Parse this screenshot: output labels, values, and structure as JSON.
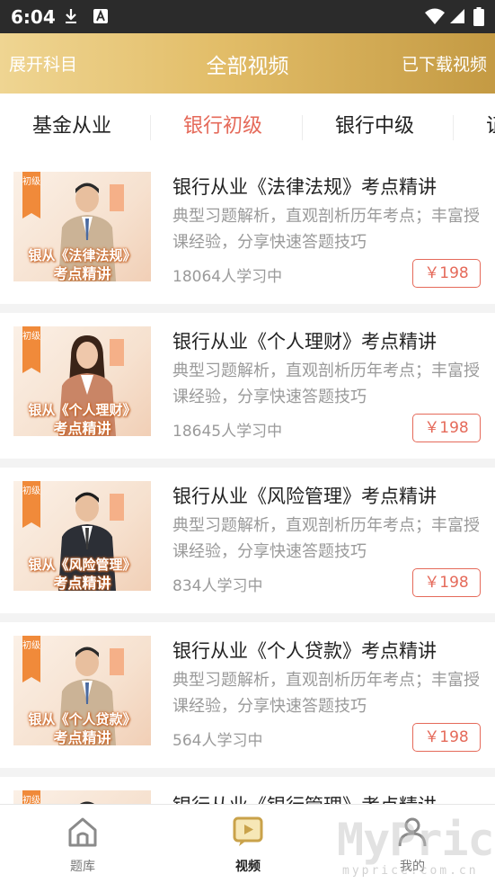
{
  "status_bar": {
    "time": "6:04",
    "left_icons": [
      "download-icon",
      "a-badge-icon"
    ],
    "right_icons": [
      "wifi-icon",
      "signal-icon",
      "battery-icon"
    ]
  },
  "header": {
    "left": "展开科目",
    "title": "全部视频",
    "right": "已下载视频"
  },
  "tabs": [
    {
      "label": "基金从业",
      "active": false
    },
    {
      "label": "银行初级",
      "active": true
    },
    {
      "label": "银行中级",
      "active": false
    },
    {
      "label": "证",
      "active": false
    }
  ],
  "courses": [
    {
      "title": "银行从业《法律法规》考点精讲",
      "desc": "典型习题解析，直观剖析历年考点；丰富授课经验，分享快速答题技巧",
      "learners": "18064人学习中",
      "price": "￥198",
      "thumb": {
        "ribbon": "初级",
        "caption1": "银从《法律法规》",
        "caption2": "考点精讲"
      }
    },
    {
      "title": "银行从业《个人理财》考点精讲",
      "desc": "典型习题解析，直观剖析历年考点；丰富授课经验，分享快速答题技巧",
      "learners": "18645人学习中",
      "price": "￥198",
      "thumb": {
        "ribbon": "初级",
        "caption1": "银从《个人理财》",
        "caption2": "考点精讲"
      }
    },
    {
      "title": "银行从业《风险管理》考点精讲",
      "desc": "典型习题解析，直观剖析历年考点；丰富授课经验，分享快速答题技巧",
      "learners": "834人学习中",
      "price": "￥198",
      "thumb": {
        "ribbon": "初级",
        "caption1": "银从《风险管理》",
        "caption2": "考点精讲"
      }
    },
    {
      "title": "银行从业《个人贷款》考点精讲",
      "desc": "典型习题解析，直观剖析历年考点；丰富授课经验，分享快速答题技巧",
      "learners": "564人学习中",
      "price": "￥198",
      "thumb": {
        "ribbon": "初级",
        "caption1": "银从《个人贷款》",
        "caption2": "考点精讲"
      }
    },
    {
      "title": "银行从业《银行管理》考点精讲",
      "desc": "",
      "learners": "",
      "price": "",
      "thumb": {
        "ribbon": "初级",
        "caption1": "",
        "caption2": ""
      }
    }
  ],
  "bottom_nav": [
    {
      "label": "题库",
      "icon": "house-icon",
      "active": false
    },
    {
      "label": "视频",
      "icon": "video-play-icon",
      "active": true
    },
    {
      "label": "我的",
      "icon": "user-icon",
      "active": false
    }
  ],
  "watermark": {
    "main": "MyPrice",
    "sub": "myprice.com.cn"
  },
  "colors": {
    "accent": "#e56a5a",
    "header_gradient_start": "#efd592",
    "header_gradient_end": "#c49a43",
    "ribbon": "#f08a3a"
  }
}
